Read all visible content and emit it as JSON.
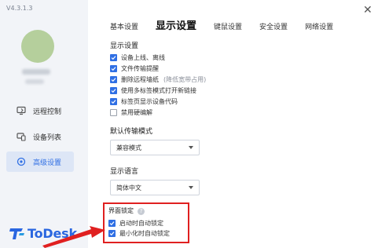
{
  "app": {
    "version": "V4.3.1.3",
    "logo_text": "ToDesk"
  },
  "sidebar": {
    "items": [
      {
        "label": "远程控制",
        "icon": "monitor-icon",
        "active": false
      },
      {
        "label": "设备列表",
        "icon": "device-list-icon",
        "active": false
      },
      {
        "label": "高级设置",
        "icon": "settings-icon",
        "active": true
      }
    ]
  },
  "tabs": [
    {
      "label": "基本设置",
      "active": false
    },
    {
      "label": "显示设置",
      "active": true
    },
    {
      "label": "键鼠设置",
      "active": false
    },
    {
      "label": "安全设置",
      "active": false
    },
    {
      "label": "网络设置",
      "active": false
    }
  ],
  "display_settings": {
    "title": "显示设置",
    "options": [
      {
        "label": "设备上线、离线",
        "checked": true,
        "hint": ""
      },
      {
        "label": "文件传输提醒",
        "checked": true,
        "hint": ""
      },
      {
        "label": "删除远程墙纸",
        "checked": true,
        "hint": "(降低宽带占用)"
      },
      {
        "label": "使用多标签模式打开新链接",
        "checked": true,
        "hint": ""
      },
      {
        "label": "标签页显示设备代码",
        "checked": true,
        "hint": ""
      },
      {
        "label": "禁用硬编解",
        "checked": false,
        "hint": ""
      }
    ]
  },
  "transfer_mode": {
    "title": "默认传输模式",
    "value": "兼容模式"
  },
  "language": {
    "title": "显示语言",
    "value": "简体中文"
  },
  "interface_lock": {
    "title": "界面锁定",
    "options": [
      {
        "label": "启动时自动锁定",
        "checked": true
      },
      {
        "label": "最小化时自动锁定",
        "checked": true
      }
    ]
  },
  "colors": {
    "accent": "#2f6fe4",
    "highlight": "#e02020",
    "sidebar_bg": "#f2f4f8"
  }
}
